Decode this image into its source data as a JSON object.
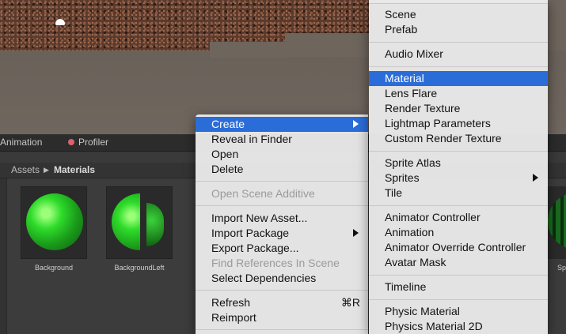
{
  "tabs": {
    "animation": "Animation",
    "profiler": "Profiler"
  },
  "breadcrumb": {
    "root": "Assets",
    "current": "Materials"
  },
  "assets": [
    {
      "label": "Background"
    },
    {
      "label": "BackgroundLeft"
    }
  ],
  "partial_asset_label": "Sp",
  "context_menu": {
    "items": [
      {
        "label": "Create",
        "highlighted": true,
        "submenu": true
      },
      {
        "label": "Reveal in Finder"
      },
      {
        "label": "Open"
      },
      {
        "label": "Delete"
      },
      {
        "label": "Open Scene Additive",
        "disabled": true
      },
      {
        "label": "Import New Asset..."
      },
      {
        "label": "Import Package",
        "submenu": true
      },
      {
        "label": "Export Package..."
      },
      {
        "label": "Find References In Scene",
        "disabled": true
      },
      {
        "label": "Select Dependencies"
      },
      {
        "label": "Refresh",
        "shortcut": "⌘R"
      },
      {
        "label": "Reimport"
      }
    ]
  },
  "create_submenu": {
    "items": [
      {
        "label": "Scene"
      },
      {
        "label": "Prefab"
      },
      {
        "label": "Audio Mixer"
      },
      {
        "label": "Material",
        "highlighted": true
      },
      {
        "label": "Lens Flare"
      },
      {
        "label": "Render Texture"
      },
      {
        "label": "Lightmap Parameters"
      },
      {
        "label": "Custom Render Texture"
      },
      {
        "label": "Sprite Atlas"
      },
      {
        "label": "Sprites",
        "submenu": true
      },
      {
        "label": "Tile"
      },
      {
        "label": "Animator Controller"
      },
      {
        "label": "Animation"
      },
      {
        "label": "Animator Override Controller"
      },
      {
        "label": "Avatar Mask"
      },
      {
        "label": "Timeline"
      },
      {
        "label": "Physic Material"
      },
      {
        "label": "Physics Material 2D"
      }
    ]
  },
  "colors": {
    "highlight": "#2a6dd9",
    "menu_bg": "#e8e8e8",
    "material_green": "#2edb2a"
  }
}
